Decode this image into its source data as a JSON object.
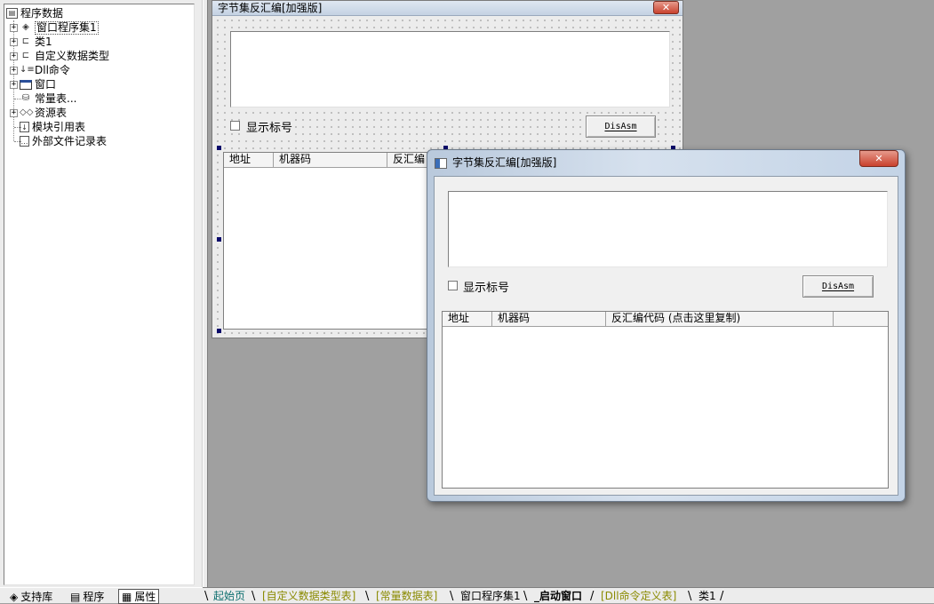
{
  "tree": {
    "root": "程序数据",
    "items": [
      {
        "label": "窗口程序集1",
        "expandable": true,
        "icon": "assembly-icon"
      },
      {
        "label": "类1",
        "expandable": true,
        "icon": "class-icon"
      },
      {
        "label": "自定义数据类型",
        "expandable": true,
        "icon": "datatype-icon"
      },
      {
        "label": "Dll命令",
        "expandable": true,
        "icon": "dll-command-icon"
      },
      {
        "label": "窗口",
        "expandable": true,
        "icon": "window-icon"
      },
      {
        "label": "常量表...",
        "expandable": false,
        "icon": "constants-icon"
      },
      {
        "label": "资源表",
        "expandable": true,
        "icon": "resources-icon"
      },
      {
        "label": "模块引用表",
        "expandable": false,
        "icon": "module-ref-icon"
      },
      {
        "label": "外部文件记录表",
        "expandable": false,
        "icon": "external-file-icon"
      }
    ]
  },
  "left_tabs": [
    {
      "label": "支持库",
      "icon": "library-icon"
    },
    {
      "label": "程序",
      "icon": "program-icon"
    },
    {
      "label": "属性",
      "icon": "properties-icon"
    }
  ],
  "design_form": {
    "title": "字节集反汇编[加强版]",
    "checkbox_label": "显示标号",
    "button_label": "DisAsm",
    "columns": [
      "地址",
      "机器码",
      "反汇编"
    ]
  },
  "window": {
    "title": "字节集反汇编[加强版]",
    "checkbox_label": "显示标号",
    "button_label": "DisAsm",
    "columns": [
      "地址",
      "机器码",
      "反汇编代码 (点击这里复制)",
      ""
    ]
  },
  "doc_tabs": [
    {
      "label": "起始页",
      "color": "#0b6e6e",
      "bold": false
    },
    {
      "label": "[自定义数据类型表]",
      "color": "#8a8a00",
      "bold": false
    },
    {
      "label": "[常量数据表]",
      "color": "#8a8a00",
      "bold": false
    },
    {
      "label": "窗口程序集1",
      "color": "#000000",
      "bold": false
    },
    {
      "label": "_启动窗口",
      "color": "#000000",
      "bold": true
    },
    {
      "label": "[Dll命令定义表]",
      "color": "#8a8a00",
      "bold": false
    },
    {
      "label": "类1",
      "color": "#000000",
      "bold": false
    }
  ],
  "colors": {
    "workspace": "#a0a0a0",
    "close_button": "#c9412d"
  }
}
